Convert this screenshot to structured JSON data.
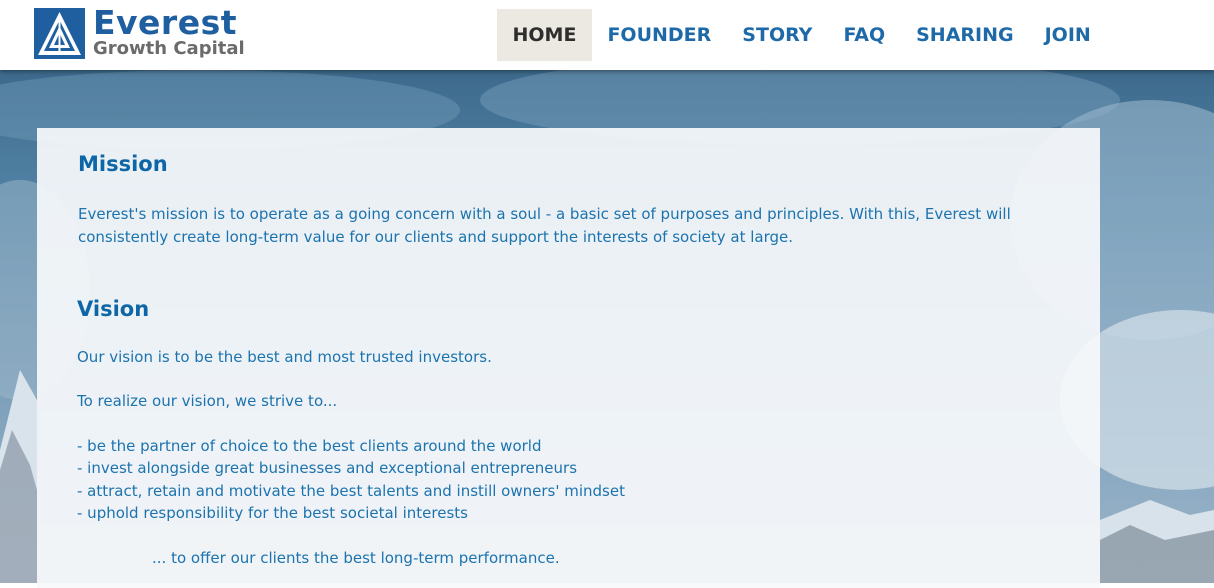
{
  "brand": {
    "name": "Everest",
    "subtitle": "Growth Capital",
    "colors": {
      "primary": "#1f5fa0",
      "text": "#1c73ae",
      "nav_active_bg": "#ece8e2"
    },
    "logo_icon": "mountain-triangle-logo"
  },
  "nav": {
    "items": [
      {
        "label": "HOME",
        "active": true
      },
      {
        "label": "FOUNDER",
        "active": false
      },
      {
        "label": "STORY",
        "active": false
      },
      {
        "label": "FAQ",
        "active": false
      },
      {
        "label": "SHARING",
        "active": false
      },
      {
        "label": "JOIN",
        "active": false
      }
    ]
  },
  "mission": {
    "title": "Mission",
    "body": "Everest's mission is to operate as a going concern with a soul - a basic set of purposes and principles. With this, Everest will consistently create long-term value for our clients and support the interests of society at large."
  },
  "vision": {
    "title": "Vision",
    "statement": "Our vision is to be the best and most trusted investors.",
    "intro": "To realize our vision, we strive to...",
    "goals": [
      "- be the partner of choice to the best clients around the world",
      "- invest alongside great businesses and exceptional entrepreneurs",
      "- attract, retain and motivate the best talents and instill owners' mindset",
      "- uphold responsibility for the best societal interests"
    ],
    "closing": "... to offer our clients the best long-term performance."
  }
}
